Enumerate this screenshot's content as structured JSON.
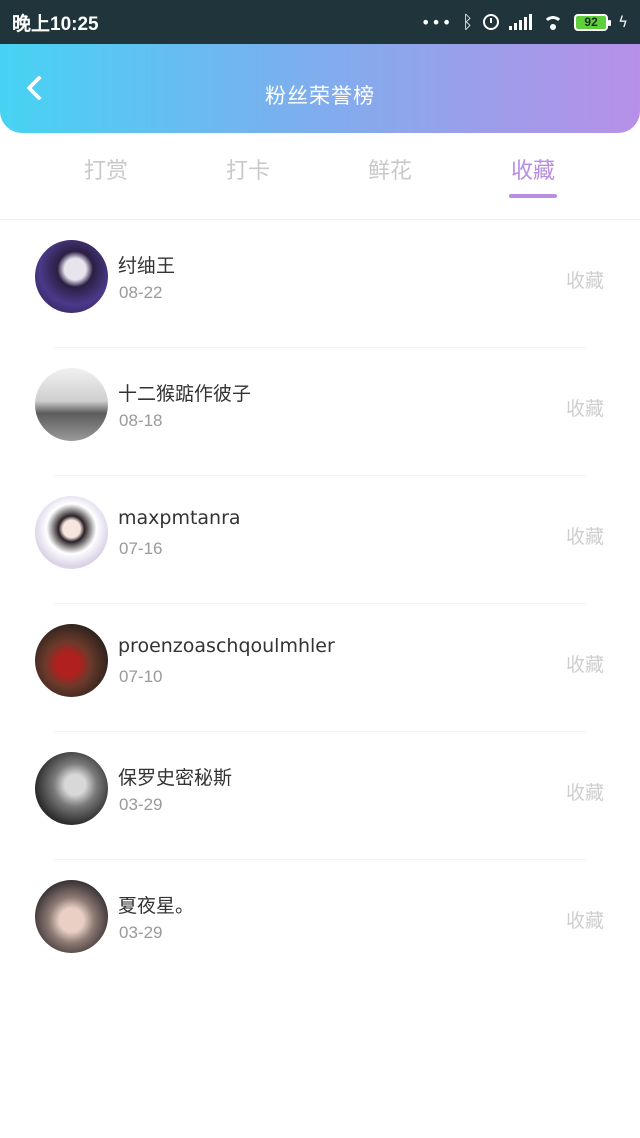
{
  "status_bar": {
    "time": "晚上10:25",
    "battery": "92"
  },
  "header": {
    "title": "粉丝荣誉榜"
  },
  "tabs": [
    {
      "label": "打赏",
      "active": false
    },
    {
      "label": "打卡",
      "active": false
    },
    {
      "label": "鲜花",
      "active": false
    },
    {
      "label": "收藏",
      "active": true
    }
  ],
  "list": {
    "items": [
      {
        "name": "纣䌷王",
        "date": "08-22",
        "action": "收藏"
      },
      {
        "name": "十二猴踮作彼子",
        "date": "08-18",
        "action": "收藏"
      },
      {
        "name": "maxpmtanra",
        "date": "07-16",
        "action": "收藏"
      },
      {
        "name": "proenzoaschqoulmhler",
        "date": "07-10",
        "action": "收藏"
      },
      {
        "name": "保罗史密秘斯",
        "date": "03-29",
        "action": "收藏"
      },
      {
        "name": "夏夜星。",
        "date": "03-29",
        "action": "收藏"
      }
    ]
  },
  "colors": {
    "accent": "#b78ee3",
    "header_gradient": [
      "#46d3f3",
      "#b790e8"
    ],
    "status_bar": "#20353b"
  }
}
